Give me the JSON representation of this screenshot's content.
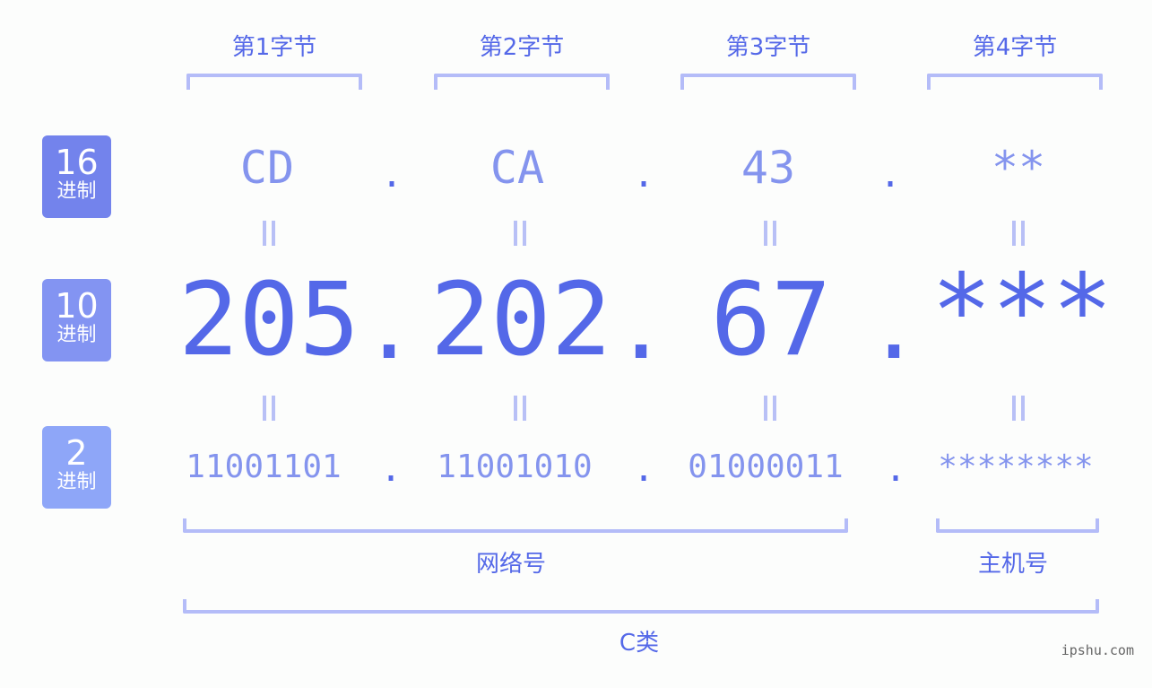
{
  "bytes": [
    {
      "label": "第1字节",
      "hex": "CD",
      "dec": "205",
      "bin": "11001101"
    },
    {
      "label": "第2字节",
      "hex": "CA",
      "dec": "202",
      "bin": "11001010"
    },
    {
      "label": "第3字节",
      "hex": "43",
      "dec": "67",
      "bin": "01000011"
    },
    {
      "label": "第4字节",
      "hex": "**",
      "dec": "***",
      "bin": "********"
    }
  ],
  "separator": ".",
  "bases": [
    {
      "num": "16",
      "unit": "进制",
      "color": "#7383ec"
    },
    {
      "num": "10",
      "unit": "进制",
      "color": "#8394f2"
    },
    {
      "num": "2",
      "unit": "进制",
      "color": "#8ea6f8"
    }
  ],
  "sections": {
    "network": "网络号",
    "host": "主机号",
    "class": "C类"
  },
  "watermark": "ipshu.com",
  "colors": {
    "accent": "#5468e8",
    "light": "#8494ee",
    "bracket": "#b4bcf8"
  }
}
